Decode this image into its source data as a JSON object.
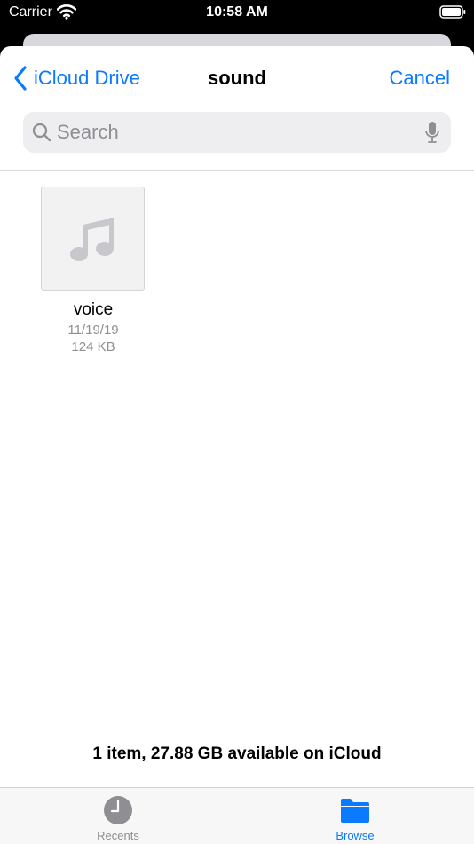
{
  "status_bar": {
    "carrier": "Carrier",
    "time": "10:58 AM"
  },
  "nav": {
    "back_label": "iCloud Drive",
    "title": "sound",
    "cancel_label": "Cancel"
  },
  "search": {
    "placeholder": "Search",
    "value": ""
  },
  "files": [
    {
      "name": "voice",
      "date": "11/19/19",
      "size": "124 KB",
      "icon": "music-note-icon"
    }
  ],
  "footer": {
    "status": "1 item, 27.88 GB available on iCloud"
  },
  "tabs": [
    {
      "label": "Recents",
      "icon": "clock-icon",
      "selected": false
    },
    {
      "label": "Browse",
      "icon": "folder-icon",
      "selected": true
    }
  ],
  "colors": {
    "accent": "#0a7aff",
    "secondary_text": "#8e8e93"
  }
}
